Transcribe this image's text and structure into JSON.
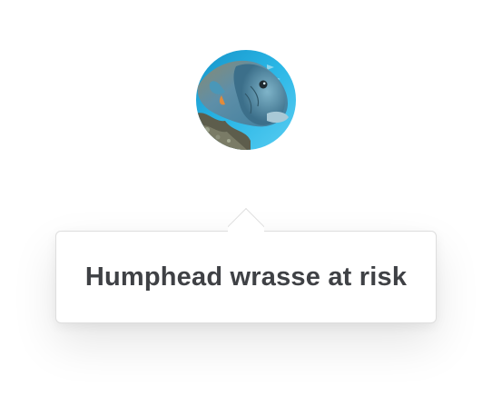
{
  "avatar": {
    "icon": "humphead-wrasse-photo",
    "colors": {
      "water": "#2bb7e6",
      "fish_body": "#5e8fa8",
      "reef": "#6b6a5a"
    }
  },
  "popover": {
    "text": "Humphead wrasse at risk",
    "text_color": "#3f4145",
    "border_color": "#dedede",
    "background": "#ffffff"
  }
}
